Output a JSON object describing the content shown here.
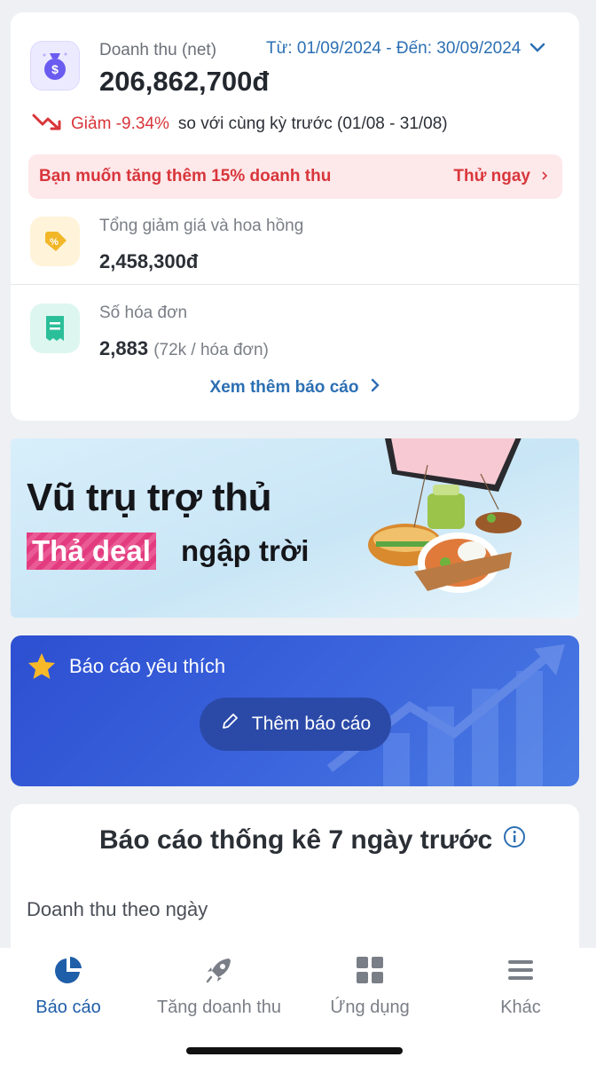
{
  "revenue": {
    "label": "Doanh thu (net)",
    "value": "206,862,700đ",
    "date_range": "Từ: 01/09/2024 - Đến: 30/09/2024",
    "trend_label": "Giảm -9.34%",
    "trend_compare": "so với cùng kỳ trước (01/08 - 31/08)"
  },
  "promo": {
    "text": "Bạn muốn tăng thêm 15% doanh thu",
    "cta": "Thử ngay"
  },
  "stats": [
    {
      "label": "Tổng giảm giá và hoa hồng",
      "value": "2,458,300đ",
      "sub": ""
    },
    {
      "label": "Số hóa đơn",
      "value": "2,883",
      "sub": "(72k / hóa đơn)"
    }
  ],
  "more_reports": "Xem thêm báo cáo",
  "banner": {
    "title": "Vũ trụ trợ thủ",
    "tag": "Thả deal",
    "sub": "ngập trời"
  },
  "favorites": {
    "title": "Báo cáo yêu thích",
    "button": "Thêm báo cáo"
  },
  "weekly": {
    "title": "Báo cáo thống kê 7 ngày trước",
    "subtitle": "Doanh thu theo ngày"
  },
  "nav": [
    {
      "label": "Báo cáo"
    },
    {
      "label": "Tăng doanh thu"
    },
    {
      "label": "Ứng dụng"
    },
    {
      "label": "Khác"
    }
  ],
  "colors": {
    "accent": "#2c6fb3",
    "alert": "#d8363b",
    "nav_active": "#1f5ea8"
  }
}
